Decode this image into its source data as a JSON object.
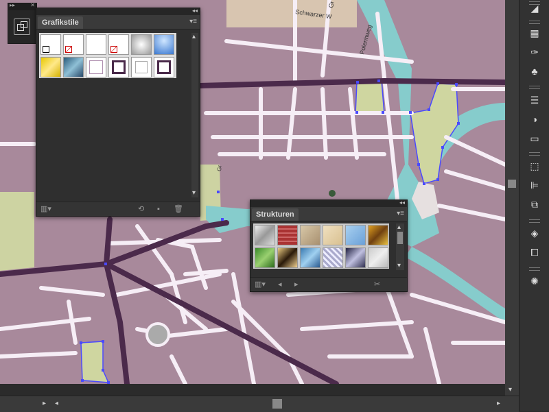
{
  "map": {
    "street_label_1": "Schwarzer W",
    "street_label_2": "Gr",
    "street_label_3": "Polenhweg",
    "street_label_4": "B",
    "street_label_5": "Gr"
  },
  "graphic_styles_panel": {
    "title": "Grafikstile",
    "collapse_icon": "double-chevron-left-icon",
    "menu_icon": "panel-menu-icon",
    "swatch_count": 12,
    "bottom_icons": [
      "library-icon",
      "break-link-icon",
      "new-style-icon",
      "delete-icon"
    ]
  },
  "textures_panel": {
    "title": "Strukturen",
    "collapse_icon": "double-chevron-left-icon",
    "menu_icon": "panel-menu-icon",
    "swatch_count": 12,
    "bottom_icons": [
      "library-icon",
      "previous-icon",
      "next-icon",
      "break-link-icon"
    ]
  },
  "left_mini_panel": {
    "collapse_label": "▸▸",
    "close_label": "✕",
    "tool": "artboard-icon"
  },
  "right_toolbar": {
    "buttons": [
      "gradient-icon",
      "swatches-grid-icon",
      "brushes-icon",
      "symbols-icon",
      "stroke-icon",
      "transparency-icon",
      "gradient-panel-icon",
      "transform-icon",
      "align-icon",
      "pathfinder-icon",
      "layers-icon",
      "artboards-icon",
      "appearance-icon"
    ]
  },
  "colors": {
    "map_block": "#a98a9a",
    "road_main": "#4a2a4a",
    "road_white": "#f7f2f7",
    "water": "#8ccfcf",
    "park": "#cfd6a0",
    "selection": "#4a4aff",
    "panel_bg": "#2f2f2f"
  }
}
